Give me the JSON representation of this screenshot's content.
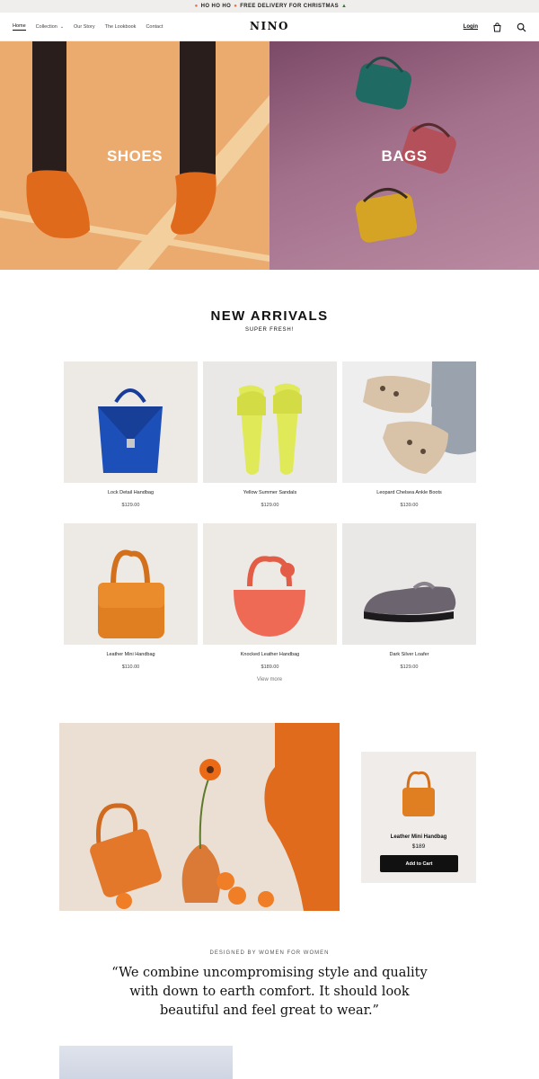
{
  "announcement": {
    "lead": "HO HO HO",
    "text": "FREE DELIVERY FOR CHRISTMAS"
  },
  "header": {
    "logo": "NINO",
    "nav": [
      "Home",
      "Collection",
      "Our Story",
      "The Lookbook",
      "Contact"
    ],
    "login": "Login",
    "icons": [
      "bag-icon",
      "search-icon"
    ]
  },
  "hero": {
    "tiles": [
      {
        "label": "SHOES"
      },
      {
        "label": "BAGS"
      }
    ]
  },
  "new_arrivals": {
    "title": "NEW ARRIVALS",
    "subtitle": "SUPER FRESH!",
    "products": [
      {
        "name": "Lock Detail Handbag",
        "price": "$129.00"
      },
      {
        "name": "Yellow Summer Sandals",
        "price": "$129.00"
      },
      {
        "name": "Leopard Chelsea Ankle Boots",
        "price": "$139.00"
      },
      {
        "name": "Leather Mini Handbag",
        "price": "$110.00"
      },
      {
        "name": "Knocked Leather Handbag",
        "price": "$189.00"
      },
      {
        "name": "Dark Silver Loafer",
        "price": "$129.00"
      }
    ],
    "view_more": "View more"
  },
  "feature": {
    "name": "Leather Mini Handbag",
    "price": "$189",
    "button": "Add to Cart"
  },
  "about": {
    "kicker": "DESIGNED BY WOMEN FOR WOMEN",
    "quote": "“We combine uncompromising style and quality with down to earth comfort. It should look beautiful and feel great to wear.”"
  },
  "colors": {
    "shoes_bg": "#ebab6f",
    "bags_bg": "#a3708b",
    "button_bg": "#111111",
    "orange": "#d8731f"
  }
}
